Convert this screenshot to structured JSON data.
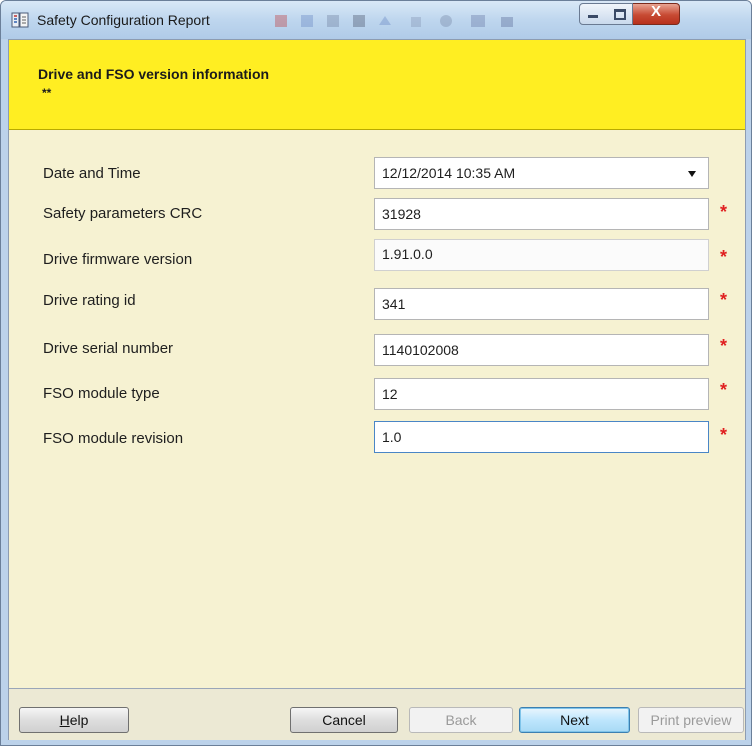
{
  "window": {
    "title": "Safety Configuration Report",
    "icon": "app-report-icon",
    "controls": {
      "minimize": "minimize-icon",
      "maximize": "maximize-icon",
      "close_label": "X"
    }
  },
  "header": {
    "title": "Drive and FSO version information",
    "subtitle": "**",
    "background_color": "#FFEE22"
  },
  "form": {
    "rows": [
      {
        "label": "Date and Time",
        "value": "12/12/2014 10:35 AM",
        "type": "dropdown",
        "required": false
      },
      {
        "label": "Safety parameters CRC",
        "value": "31928",
        "type": "text",
        "required": true
      },
      {
        "label": "Drive firmware version",
        "value": "1.91.0.0",
        "type": "readonly",
        "required": true
      },
      {
        "label": "Drive rating id",
        "value": "341",
        "type": "text",
        "required": true
      },
      {
        "label": "Drive serial number",
        "value": "1140102008",
        "type": "text",
        "required": true
      },
      {
        "label": "FSO module type",
        "value": "12",
        "type": "text",
        "required": true
      },
      {
        "label": "FSO module revision",
        "value": "1.0",
        "type": "text",
        "required": true,
        "focused": true
      }
    ],
    "required_marker": "*",
    "required_color": "#E02020"
  },
  "footer": {
    "help_label_underlined": "H",
    "help_label_rest": "elp",
    "cancel_label": "Cancel",
    "back_label": "Back",
    "next_label": "Next",
    "print_preview_label": "Print preview"
  }
}
